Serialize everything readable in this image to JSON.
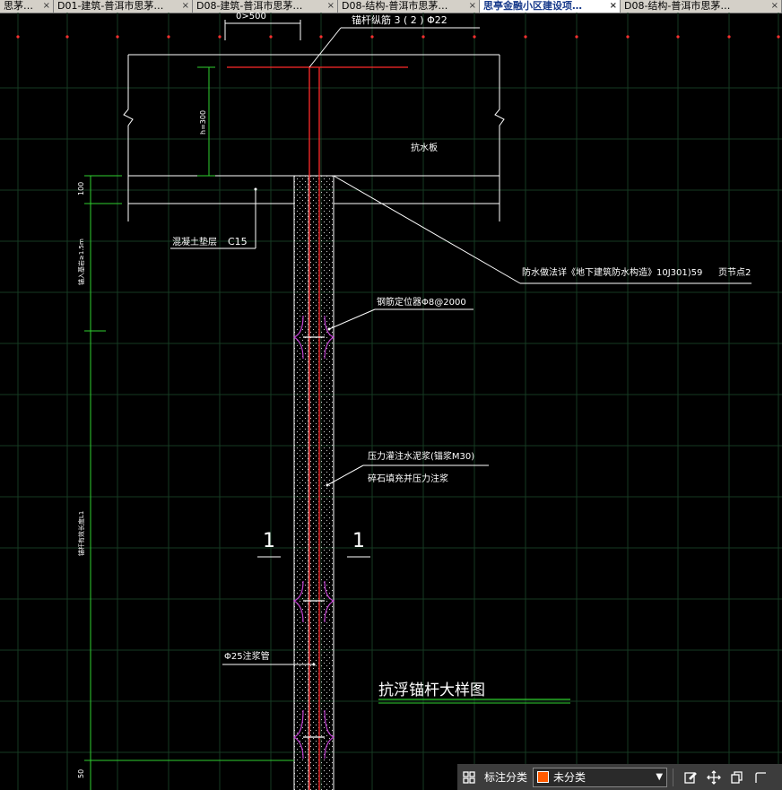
{
  "tabs": [
    {
      "label": "思茅…"
    },
    {
      "label": "D01-建筑-普洱市思茅…"
    },
    {
      "label": "D08-建筑-普洱市思茅…"
    },
    {
      "label": "D08-结构-普洱市思茅…"
    },
    {
      "label": "思亭金融小区建设项…",
      "active": true
    },
    {
      "label": "D08-结构-普洱市思茅…"
    }
  ],
  "drawing": {
    "top_dim": "0>500",
    "anchor_bar_label": "锚杆纵筋 3 ( 2 ) Φ22",
    "slab_label": "抗水板",
    "slab_dim": "h=300",
    "cushion_label": "混凝土垫层",
    "cushion_grade": "C15",
    "dim_100": "100",
    "dim_embed": "锚入基岩≥1.5m",
    "waterproof_note": "防水做法详《地下建筑防水构造》10J301)59",
    "waterproof_page": "页节点2",
    "centralizer_label": "钢筋定位器Φ8@2000",
    "grout_label_1": "压力灌注水泥浆(锚浆M30)",
    "grout_label_2": "碎石填充并压力注浆",
    "section_left": "1",
    "section_right": "1",
    "grout_pipe_label": "Φ25注浆管",
    "dim_anchor_len": "锚杆有效长度L1",
    "dim_50": "50",
    "title": "抗浮锚杆大样图"
  },
  "statusbar": {
    "label": "标注分类",
    "category_value": "未分类",
    "category_color": "#ff5a00"
  }
}
